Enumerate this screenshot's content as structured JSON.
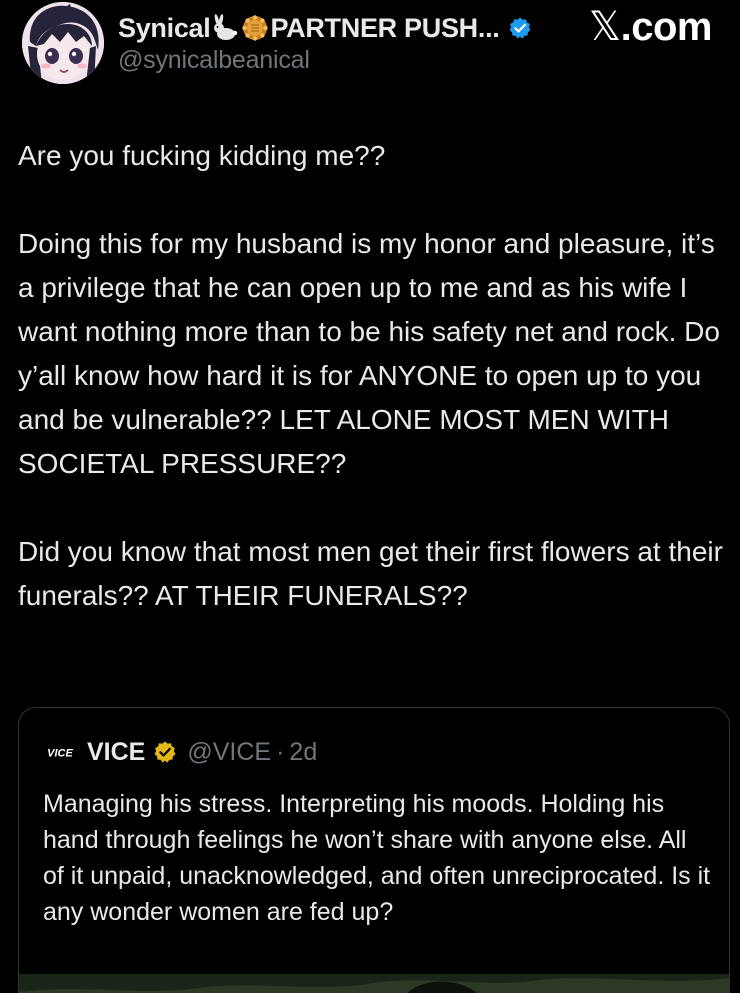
{
  "header": {
    "display_name": "Synical",
    "name_suffix": "PARTNER PUSH...",
    "handle": "@synicalbeanical",
    "site_label": ".com",
    "site_mark": "𝕏",
    "icons": {
      "avatar": "anime-avatar",
      "emoji_1": "rabbit-emoji",
      "emoji_2": "mooncake-emoji",
      "verified": "verified-badge-icon"
    },
    "colors": {
      "verified": "#1d9bf0"
    }
  },
  "tweet": {
    "paragraphs": [
      "Are you fucking kidding me??",
      "Doing this for my husband is my honor and pleasure, it’s a privilege that he can open up to me and as his wife I want nothing more than to be his safety net and rock. Do y’all know how hard it is for ANYONE to open up to you and be vulnerable?? LET ALONE MOST MEN WITH SOCIETAL PRESSURE??",
      "Did you know that most men get their first flowers at their funerals?? AT THEIR FUNERALS??"
    ]
  },
  "quote": {
    "logo_text": "VICE",
    "name": "VICE",
    "handle": "@VICE",
    "separator": "·",
    "time": "2d",
    "text": "Managing his stress. Interpreting his moods. Holding his hand through feelings he won’t share with anyone else. All of it unpaid, unacknowledged, and often unreciprocated. Is it any wonder women are fed up?",
    "colors": {
      "gold_check": "#e2b719"
    }
  }
}
